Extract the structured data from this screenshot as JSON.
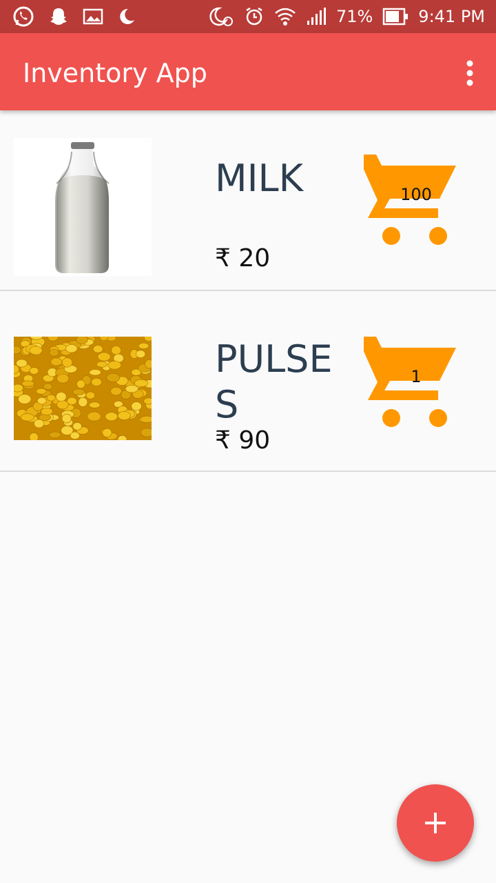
{
  "status_bar": {
    "battery": "71%",
    "time": "9:41 PM",
    "icons_left": [
      "whatsapp-icon",
      "snapchat-icon",
      "gallery-icon",
      "moon-icon"
    ],
    "icons_right": [
      "night-alarm-icon",
      "alarm-icon",
      "wifi-icon",
      "signal-icon",
      "battery-icon"
    ]
  },
  "app_bar": {
    "title": "Inventory App",
    "menu_icon": "overflow-menu-icon"
  },
  "items": [
    {
      "name": "MILK",
      "price": "₹ 20",
      "quantity": "100",
      "image": "milk-bottle-image"
    },
    {
      "name": "PULSES",
      "price": "₹ 90",
      "quantity": "1",
      "image": "yellow-lentils-image"
    }
  ],
  "fab": {
    "icon": "plus-icon"
  },
  "colors": {
    "primary": "#f0524f",
    "primary_dark": "#b83b37",
    "accent": "#ff9800"
  }
}
